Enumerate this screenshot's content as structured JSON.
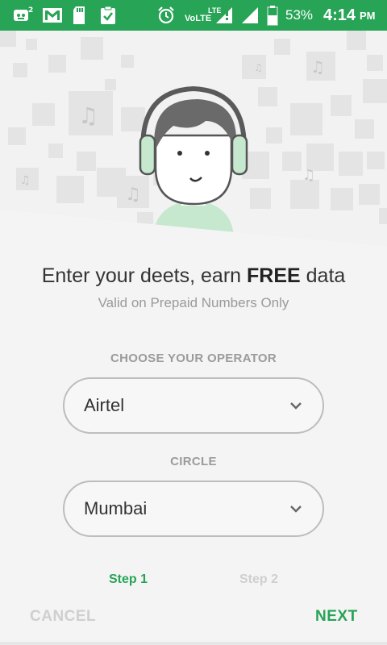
{
  "status_bar": {
    "background_color": "#27a456",
    "left_icons": [
      "app-notification-icon",
      "gmail-icon",
      "sd-card-icon",
      "clipboard-check-icon"
    ],
    "right_icons": [
      "alarm-icon",
      "volte-icon",
      "signal-icon",
      "signal-icon",
      "battery-icon"
    ],
    "volte_label": "VoLTE",
    "lte_label": "LTE",
    "battery_percent": "53%",
    "time": "4:14",
    "ampm": "PM"
  },
  "hero": {
    "illustration": "person-with-headphones",
    "background_tiles": "music-note-tiles"
  },
  "content": {
    "headline_prefix": "Enter your deets, earn ",
    "headline_bold": "FREE",
    "headline_suffix": " data",
    "subline": "Valid on Prepaid Numbers Only"
  },
  "operator": {
    "label": "CHOOSE YOUR OPERATOR",
    "value": "Airtel"
  },
  "circle": {
    "label": "CIRCLE",
    "value": "Mumbai"
  },
  "steps": [
    {
      "label": "Step 1",
      "active": true
    },
    {
      "label": "Step 2",
      "active": false
    }
  ],
  "actions": {
    "cancel_label": "CANCEL",
    "next_label": "NEXT"
  },
  "colors": {
    "accent": "#27a456",
    "disabled": "#cfcfcf",
    "label_gray": "#9b9b9b"
  }
}
